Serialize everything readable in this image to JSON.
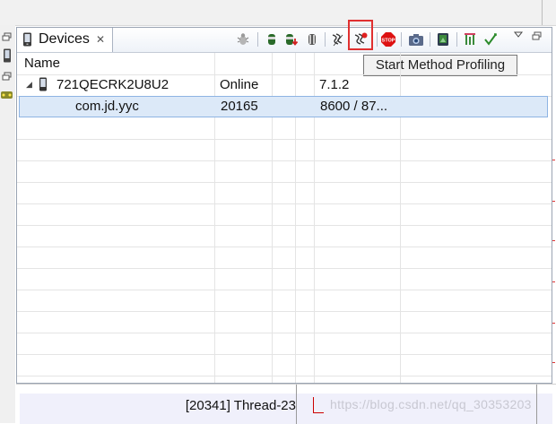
{
  "panel": {
    "tab_title": "Devices",
    "tab_close": "✕"
  },
  "toolbar": {
    "tooltip": "Start Method Profiling",
    "highlighted_button": "start-method-profiling"
  },
  "table": {
    "headers": [
      "Name",
      "",
      "",
      "",
      ""
    ],
    "rows": [
      {
        "name": "721QECRK2U8U2",
        "col2": "Online",
        "col5": "7.1.2",
        "expanded": true,
        "selected": false
      },
      {
        "name": "com.jd.yyc",
        "col2": "20165",
        "col5": "8600 / 87...",
        "selected": true
      }
    ]
  },
  "bottom": {
    "thread_label": "[20341] Thread-23",
    "watermark": "https://blog.csdn.net/qq_30353203"
  },
  "colors": {
    "highlight_border": "#e03030",
    "selection_bg": "#dce9f8"
  }
}
